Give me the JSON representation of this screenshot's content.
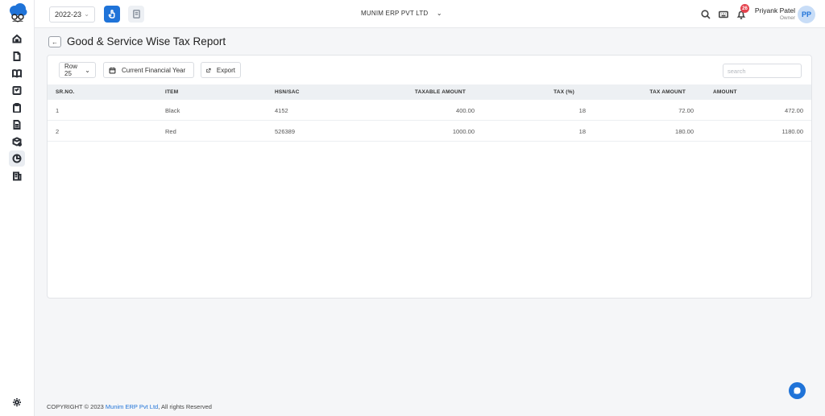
{
  "topbar": {
    "year": "2022-23",
    "company": "MUNIM ERP PVT LTD",
    "notification_count": "26",
    "user_name": "Priyank Patel",
    "user_role": "Owner",
    "avatar_initials": "PP"
  },
  "page": {
    "title": "Good & Service Wise Tax Report"
  },
  "toolbar": {
    "rows_label": "Row 25",
    "period_label": "Current Financial Year",
    "export_label": "Export",
    "search_placeholder": "search"
  },
  "table": {
    "headers": [
      "SR.NO.",
      "ITEM",
      "HSN/SAC",
      "TAXABLE AMOUNT",
      "TAX (%)",
      "TAX AMOUNT",
      "AMOUNT"
    ],
    "rows": [
      [
        "1",
        "Black",
        "4152",
        "400.00",
        "18",
        "72.00",
        "472.00"
      ],
      [
        "2",
        "Red",
        "526389",
        "1000.00",
        "18",
        "180.00",
        "1180.00"
      ]
    ]
  },
  "footer": {
    "prefix": "COPYRIGHT © 2023 ",
    "link": "Munim ERP Pvt Ltd",
    "suffix": ", All rights Reserved"
  },
  "colors": {
    "accent": "#1f73d8",
    "badge": "#e4424d",
    "header_bg": "#edf0f3"
  }
}
